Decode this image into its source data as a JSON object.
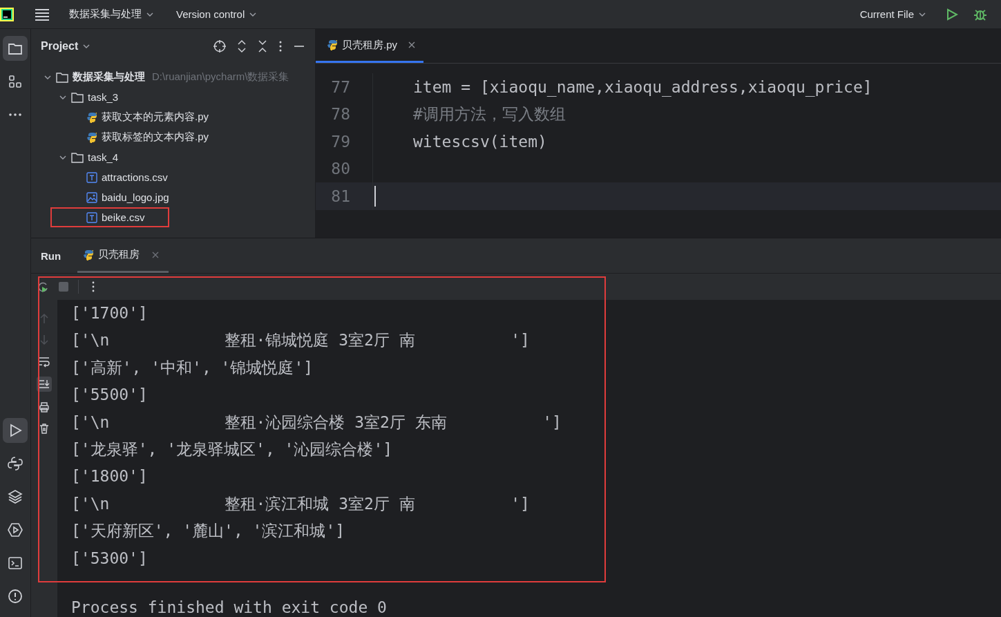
{
  "top_bar": {
    "project_name": "数据采集与处理",
    "vcs": "Version control",
    "run_config": "Current File"
  },
  "tool_strip": {
    "top": [
      {
        "kind": "folder",
        "selected": true
      },
      {
        "kind": "structure",
        "selected": false
      },
      {
        "kind": "more",
        "selected": false
      }
    ],
    "bottom": [
      {
        "kind": "run",
        "selected": true
      },
      {
        "kind": "python",
        "selected": false
      },
      {
        "kind": "layers",
        "selected": false
      },
      {
        "kind": "services",
        "selected": false
      },
      {
        "kind": "terminal",
        "selected": false
      },
      {
        "kind": "problems",
        "selected": false
      }
    ]
  },
  "project_panel": {
    "title": "Project",
    "tree": [
      {
        "label": "数据采集与处理",
        "path": "D:\\ruanjian\\pycharm\\数据采集",
        "kind": "folder",
        "expanded": true,
        "children": [
          {
            "label": "task_3",
            "kind": "folder",
            "expanded": true,
            "children": [
              {
                "label": "获取文本的元素内容.py",
                "kind": "python"
              },
              {
                "label": "获取标签的文本内容.py",
                "kind": "python"
              }
            ]
          },
          {
            "label": "task_4",
            "kind": "folder",
            "expanded": true,
            "children": [
              {
                "label": "attractions.csv",
                "kind": "text",
                "highlighted": false
              },
              {
                "label": "baidu_logo.jpg",
                "kind": "image",
                "highlighted": false
              },
              {
                "label": "beike.csv",
                "kind": "text",
                "highlighted": true
              }
            ]
          }
        ]
      }
    ]
  },
  "editor": {
    "tabs": [
      {
        "label": "贝壳租房.py",
        "selected": true
      }
    ],
    "lines": [
      {
        "number": "77",
        "kind": "code",
        "code": "item = [xiaoqu_name,xiaoqu_address,xiaoqu_price]",
        "current": false
      },
      {
        "number": "78",
        "kind": "comment",
        "code": "#调用方法，写入数组",
        "current": false
      },
      {
        "number": "79",
        "kind": "code",
        "code": "witescsv(item)",
        "current": false
      },
      {
        "number": "80",
        "kind": "blank",
        "current": false
      },
      {
        "number": "81",
        "kind": "blank",
        "current": true
      }
    ]
  },
  "run_panel": {
    "title": "Run",
    "tabs": [
      {
        "label": "贝壳租房",
        "selected": true
      }
    ],
    "output_highlighted": true,
    "output": [
      "['1700']",
      "['\\n            整租·锦城悦庭 3室2厅 南          ']",
      "['高新', '中和', '锦城悦庭']",
      "['5500']",
      "['\\n            整租·沁园综合楼 3室2厅 东南          ']",
      "['龙泉驿', '龙泉驿城区', '沁园综合楼']",
      "['1800']",
      "['\\n            整租·滨江和城 3室2厅 南          ']",
      "['天府新区', '麓山', '滨江和城']",
      "['5300']"
    ],
    "exit_message": "Process finished with exit code 0"
  }
}
